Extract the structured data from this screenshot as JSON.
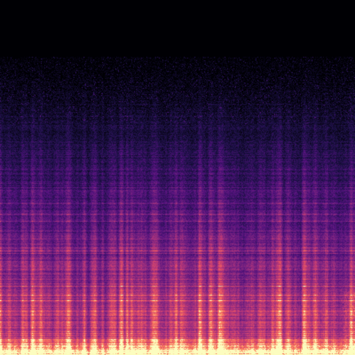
{
  "image": {
    "kind": "spectrogram",
    "colormap": "magma",
    "colormap_stops": [
      "#000004",
      "#1d1147",
      "#51127c",
      "#822681",
      "#b73779",
      "#e75263",
      "#fc8961",
      "#fcfdbf"
    ],
    "background_color": "#000000",
    "labels_visible": false
  }
}
